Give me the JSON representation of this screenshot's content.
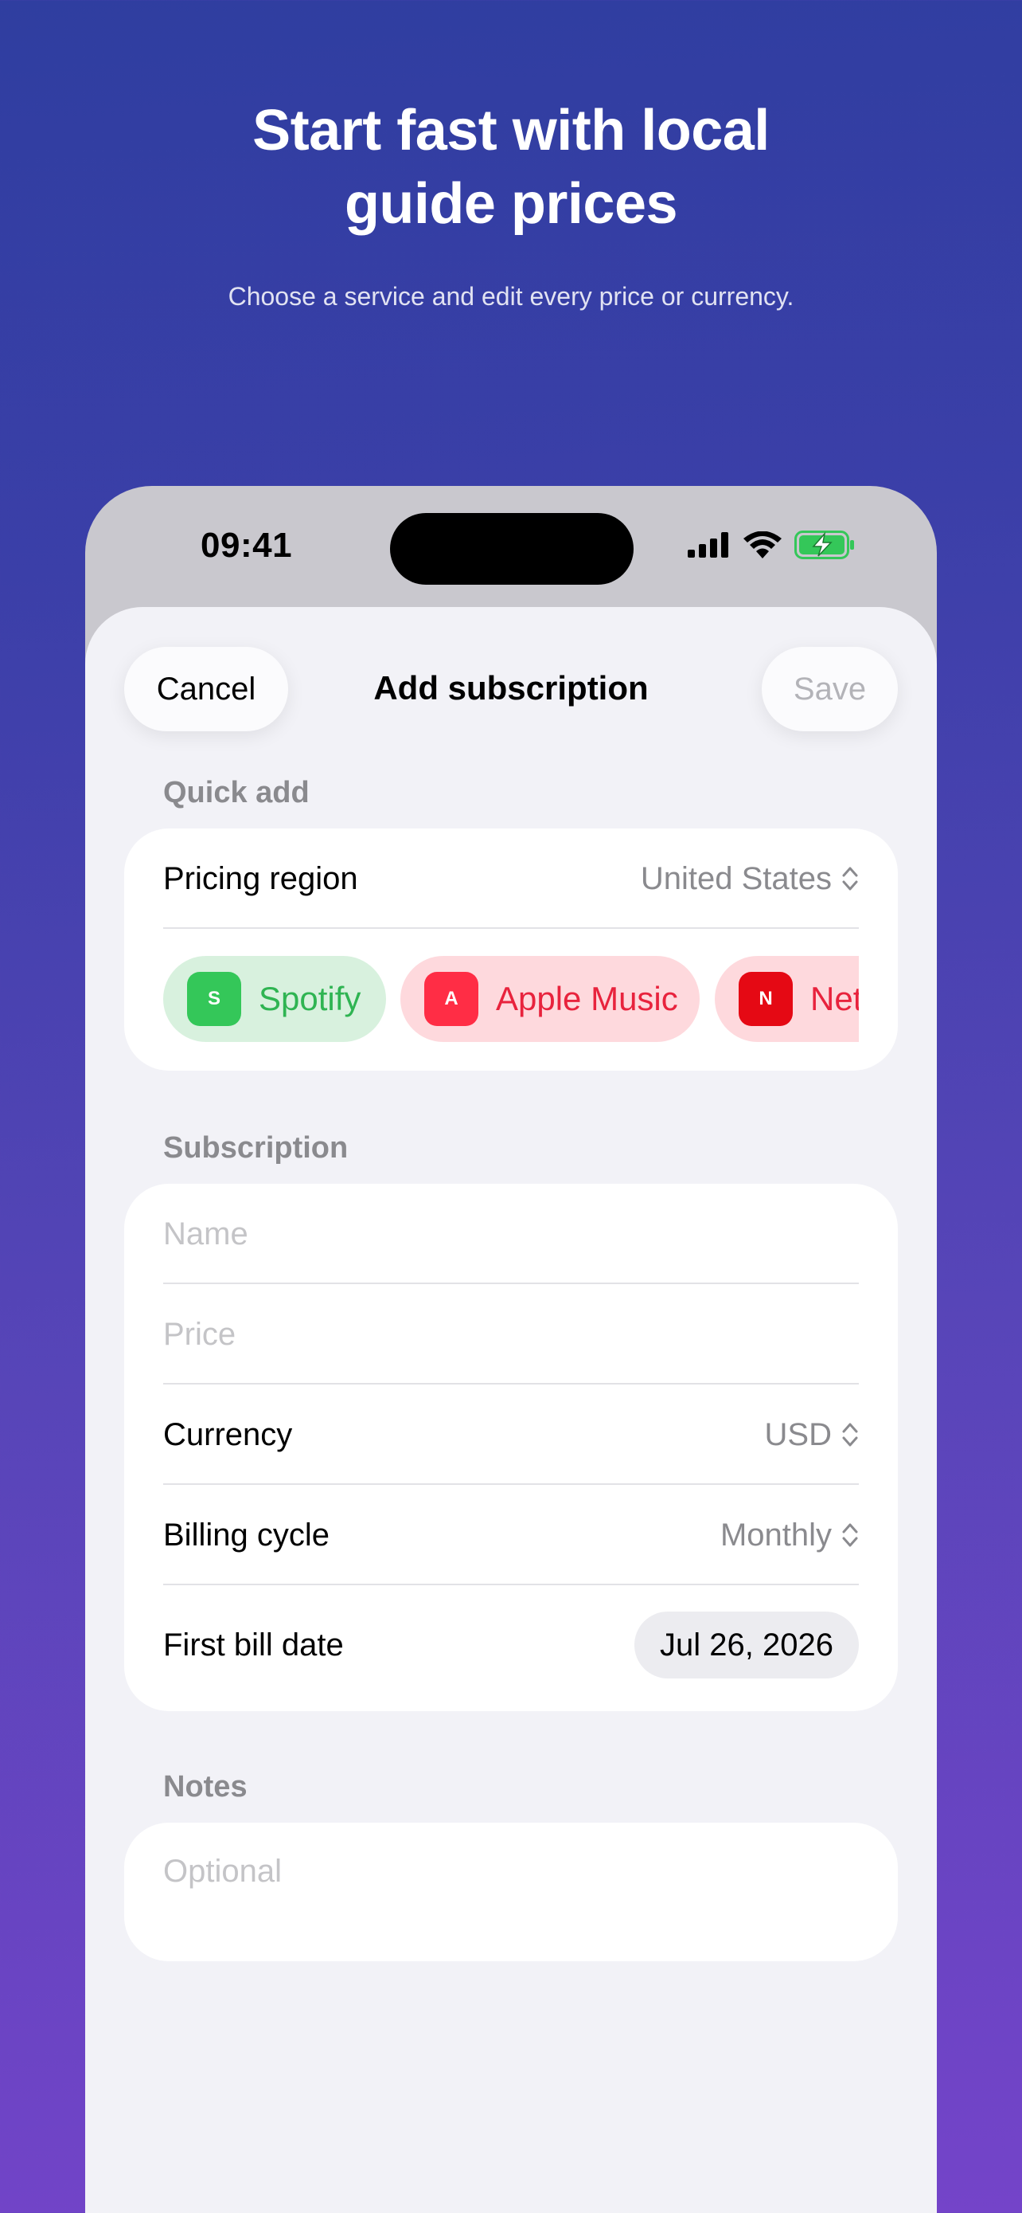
{
  "hero": {
    "title_line1": "Start fast with local",
    "title_line2": "guide prices",
    "subtitle": "Choose a service and edit every price or currency."
  },
  "status_bar": {
    "time": "09:41",
    "icons": [
      "signal-icon",
      "wifi-icon",
      "battery-charging-icon"
    ]
  },
  "nav": {
    "cancel_label": "Cancel",
    "title": "Add subscription",
    "save_label": "Save"
  },
  "quick_add": {
    "header": "Quick add",
    "region_label": "Pricing region",
    "region_value": "United States",
    "services": [
      {
        "badge": "S",
        "name": "Spotify",
        "color": "#34c759"
      },
      {
        "badge": "A",
        "name": "Apple Music",
        "color": "#ff2d45"
      },
      {
        "badge": "N",
        "name": "Netflix",
        "color": "#e50914"
      }
    ]
  },
  "subscription": {
    "header": "Subscription",
    "name_placeholder": "Name",
    "price_placeholder": "Price",
    "currency_label": "Currency",
    "currency_value": "USD",
    "billing_label": "Billing cycle",
    "billing_value": "Monthly",
    "first_bill_label": "First bill date",
    "first_bill_value": "Jul 26, 2026"
  },
  "notes": {
    "header": "Notes",
    "placeholder": "Optional"
  }
}
